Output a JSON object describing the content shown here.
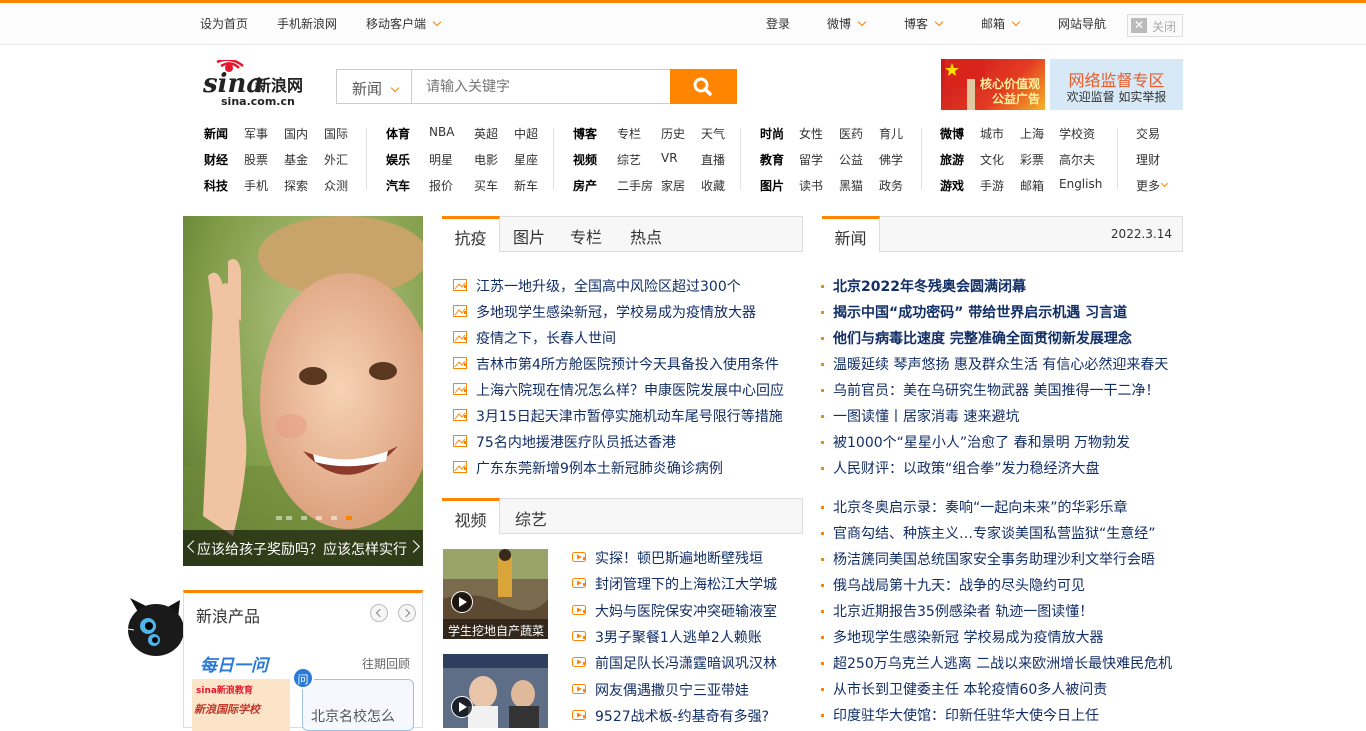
{
  "topbar": {
    "left": [
      "设为首页",
      "手机新浪网",
      "移动客户端"
    ],
    "right": [
      "登录",
      "微博",
      "博客",
      "邮箱",
      "网站导航"
    ],
    "close": "关闭"
  },
  "logo": {
    "brand": "sina新浪网",
    "domain": "sina.com.cn"
  },
  "search": {
    "category": "新闻",
    "placeholder": "请输入关键字"
  },
  "ads": {
    "left_text": "核心价值观\n公益广告",
    "right_title": "网络监督专区",
    "right_sub": "欢迎监督 如实举报"
  },
  "nav": {
    "groups": [
      {
        "rows": [
          [
            "新闻",
            "军事",
            "国内",
            "国际"
          ],
          [
            "财经",
            "股票",
            "基金",
            "外汇"
          ],
          [
            "科技",
            "手机",
            "探索",
            "众测"
          ]
        ]
      },
      {
        "rows": [
          [
            "体育",
            "NBA",
            "英超",
            "中超"
          ],
          [
            "娱乐",
            "明星",
            "电影",
            "星座"
          ],
          [
            "汽车",
            "报价",
            "买车",
            "新车"
          ]
        ]
      },
      {
        "rows": [
          [
            "博客",
            "专栏",
            "历史",
            "天气"
          ],
          [
            "视频",
            "综艺",
            "VR",
            "直播"
          ],
          [
            "房产",
            "二手房",
            "家居",
            "收藏"
          ]
        ]
      },
      {
        "rows": [
          [
            "时尚",
            "女性",
            "医药",
            "育儿"
          ],
          [
            "教育",
            "留学",
            "公益",
            "佛学"
          ],
          [
            "图片",
            "读书",
            "黑猫",
            "政务"
          ]
        ]
      },
      {
        "rows": [
          [
            "微博",
            "城市",
            "上海",
            "学校资"
          ],
          [
            "旅游",
            "文化",
            "彩票",
            "高尔夫"
          ],
          [
            "游戏",
            "手游",
            "邮箱",
            "English"
          ]
        ]
      },
      {
        "rows": [
          [
            "交易"
          ],
          [
            "理财"
          ],
          [
            "更多"
          ]
        ]
      }
    ]
  },
  "focus": {
    "caption": "应该给孩子奖励吗？应该怎样实行"
  },
  "tabs_mid": [
    "抗疫",
    "图片",
    "专栏",
    "热点"
  ],
  "mid_news": [
    "江苏一地升级，全国高中风险区超过300个",
    "多地现学生感染新冠，学校易成为疫情放大器",
    "疫情之下，长春人世间",
    "吉林市第4所方舱医院预计今天具备投入使用条件",
    "上海六院现在情况怎么样？申康医院发展中心回应",
    "3月15日起天津市暂停实施机动车尾号限行等措施",
    "75名内地援港医疗队员抵达香港",
    "广东东莞新增9例本土新冠肺炎确诊病例"
  ],
  "tabs_video": [
    "视频",
    "综艺"
  ],
  "video_thumbs": [
    {
      "caption": "学生挖地自产蔬菜"
    },
    {
      "caption": ""
    }
  ],
  "video_news": [
    "实探！顿巴斯遍地断壁残垣",
    "封闭管理下的上海松江大学城",
    "大妈与医院保安冲突砸输液室",
    "3男子聚餐1人逃单2人赖账",
    "前国足队长冯潇霆暗讽巩汉林",
    "网友偶遇撒贝宁三亚带娃",
    "9527战术板-约基奇有多强?"
  ],
  "news_header": {
    "tab": "新闻",
    "date": "2022.3.14"
  },
  "news_bold": [
    "北京2022年冬残奥会圆满闭幕",
    "揭示中国“成功密码” 带给世界启示机遇 习言道",
    "他们与病毒比速度 完整准确全面贯彻新发展理念"
  ],
  "news_normal": [
    "温暖延续 琴声悠扬 惠及群众生活 有信心必然迎来春天",
    "乌前官员：美在乌研究生物武器 美国推得一干二净！",
    "一图读懂丨居家消毒 速来避坑",
    "被1000个“星星小人”治愈了 春和景明 万物勃发",
    "人民财评：以政策“组合拳”发力稳经济大盘"
  ],
  "news_more": [
    "北京冬奥启示录：奏响“一起向未来”的华彩乐章",
    "官商勾结、种族主义…专家谈美国私营监狱“生意经”",
    "杨洁篪同美国总统国家安全事务助理沙利文举行会晤",
    "俄乌战局第十九天：战争的尽头隐约可见",
    "北京近期报告35例感染者 轨迹一图读懂！",
    "多地现学生感染新冠 学校易成为疫情放大器",
    "超250万乌克兰人逃离 二战以来欧洲增长最快难民危机",
    "从市长到卫健委主任 本轮疫情60多人被问责",
    "印度驻华大使馆：印新任驻华大使今日上任"
  ],
  "products": {
    "title": "新浪产品",
    "daily": "每日一问",
    "past": "往期回顾",
    "promo": "sina新浪教育",
    "promo_sub": "新浪国际学校",
    "question": "北京名校怎么",
    "ask_badge": "问"
  },
  "colors": {
    "accent": "#ff8400",
    "link": "#122e67"
  }
}
